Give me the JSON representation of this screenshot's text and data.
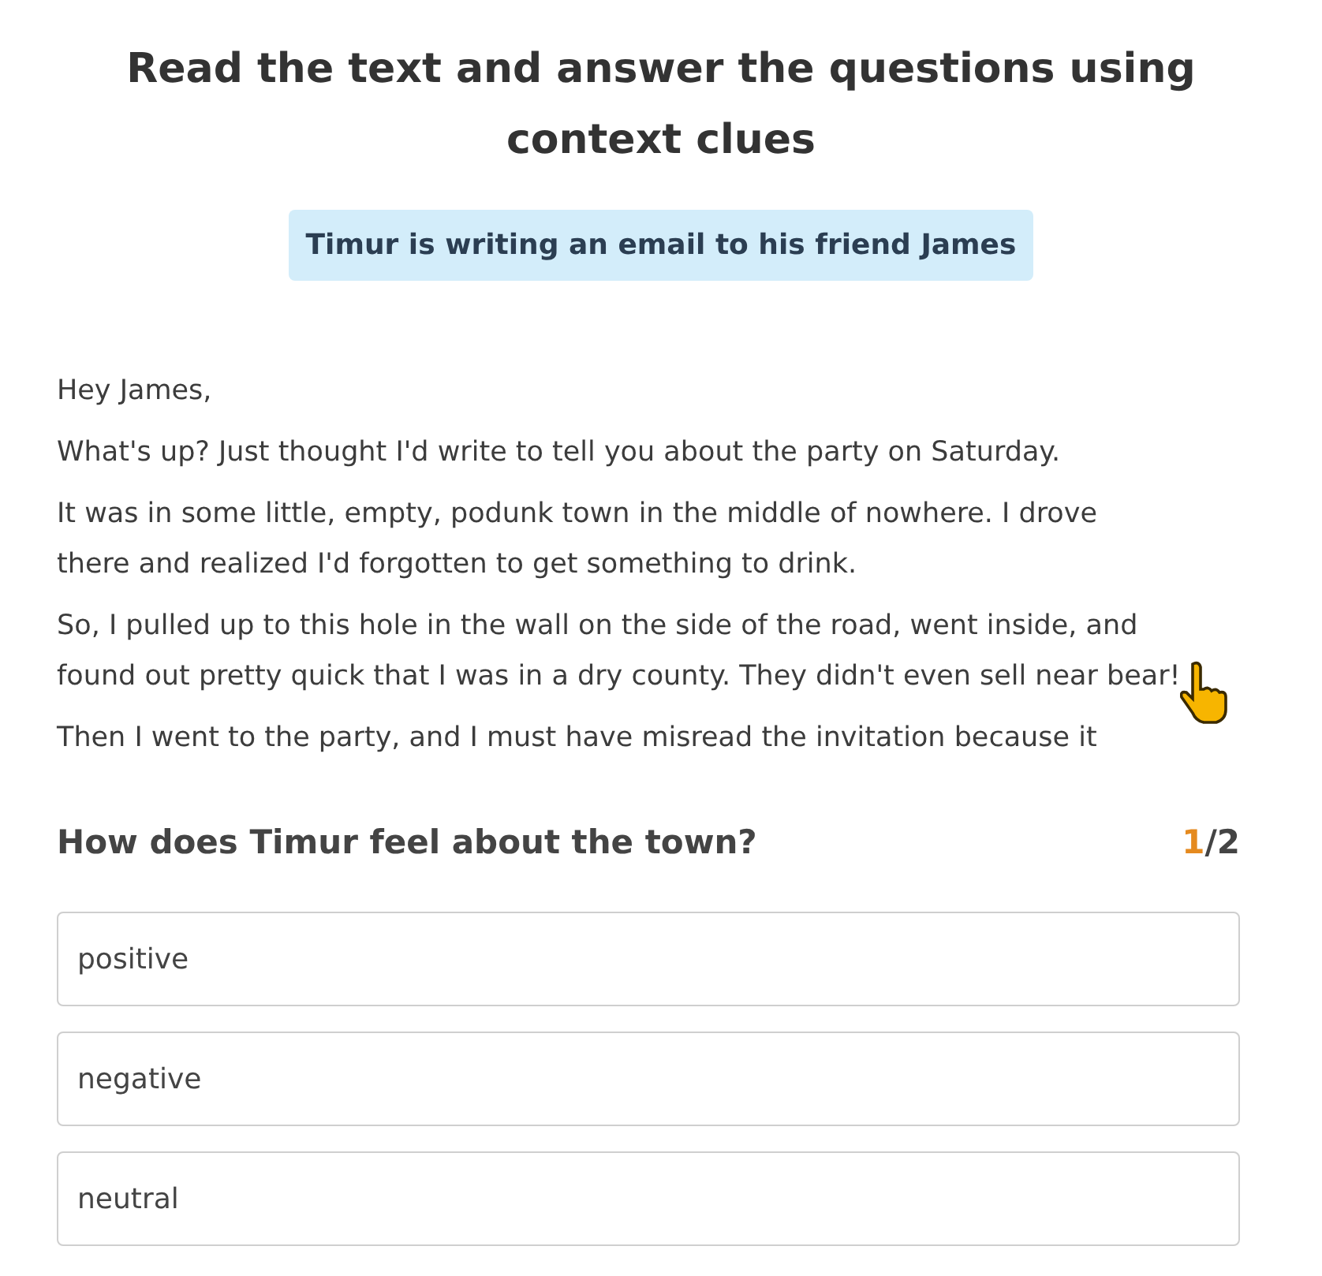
{
  "title": "Read the text and answer the questions using context clues",
  "banner": "Timur is writing an email to his friend James",
  "email": [
    {
      "lines": [
        "Hey James,"
      ]
    },
    {
      "lines": [
        "What's up? Just thought I'd write to tell you about the party on Saturday."
      ]
    },
    {
      "lines": [
        "It was in some little, empty, podunk town in the middle of nowhere. I drove",
        "there and realized I'd forgotten to get something to drink."
      ]
    },
    {
      "lines": [
        "So, I pulled up to this hole in the wall on the side of the road, went inside, and",
        "found out pretty quick that I was in a dry county. They didn't even sell near bear!"
      ]
    },
    {
      "lines": [
        "Then I went to the party, and I must have misread the invitation because it"
      ]
    }
  ],
  "question": {
    "text": "How does Timur feel about the town?",
    "current": "1",
    "separator": "/",
    "total": "2"
  },
  "options": [
    {
      "label": "positive"
    },
    {
      "label": "negative"
    },
    {
      "label": "neutral"
    }
  ]
}
